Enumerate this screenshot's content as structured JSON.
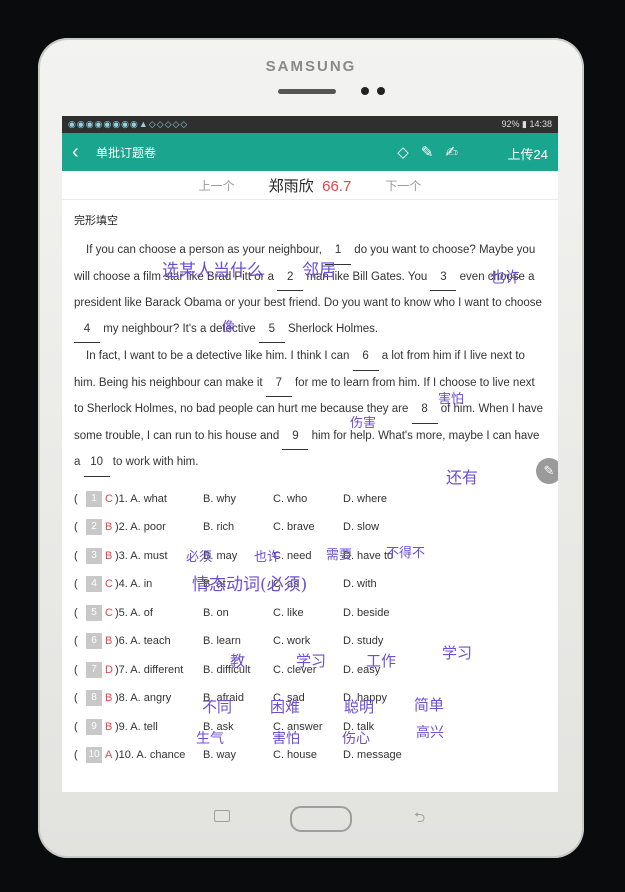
{
  "device": {
    "brand": "SAMSUNG"
  },
  "status_bar": {
    "left_icons": "◉◉◉◉◉◉◉◉▲◇◇◇◇◇",
    "right": "92% ▮ 14:38"
  },
  "app_bar": {
    "title": "单批订题卷",
    "upload_label": "上传24"
  },
  "student_bar": {
    "prev_label": "上一个",
    "student_name": "郑雨欣",
    "score": "66.7",
    "next_label": "下一个"
  },
  "section_title": "完形填空",
  "paragraphs": [
    {
      "segments": [
        "If you can choose a person as your neighbour, ",
        "1",
        " do you want to choose? Maybe you will choose a film star like Brad Pitt or a ",
        "2",
        " man like Bill Gates. You ",
        "3",
        " even choose a president like Barack Obama or your best friend. Do you want to know who I want to choose ",
        "4",
        " my neighbour? It's a detective ",
        "5",
        " Sherlock Holmes."
      ]
    },
    {
      "segments": [
        "In fact, I want to be a detective like him. I think I can ",
        "6",
        " a lot from him if I live next to him. Being his neighbour can make it ",
        "7",
        " for me to learn from him. If I choose to live next to Sherlock Holmes, no bad people can hurt me because they are ",
        "8",
        " of him. When I have some trouble, I can run to his house and ",
        "9",
        " him for help. What's more, maybe I can have a ",
        "10",
        " to work with him."
      ]
    }
  ],
  "questions": [
    {
      "num": "1",
      "ans": "C",
      "a": ")1. A. what",
      "b": "B. why",
      "c": "C. who",
      "d": "D. where"
    },
    {
      "num": "2",
      "ans": "B",
      "a": ")2. A. poor",
      "b": "B. rich",
      "c": "C. brave",
      "d": "D. slow"
    },
    {
      "num": "3",
      "ans": "B",
      "a": ")3. A. must",
      "b": "B. may",
      "c": "C. need",
      "d": "D. have to"
    },
    {
      "num": "4",
      "ans": "C",
      "a": ")4. A. in",
      "b": "B. at",
      "c": "C. as",
      "d": "D. with"
    },
    {
      "num": "5",
      "ans": "C",
      "a": ")5. A. of",
      "b": "B. on",
      "c": "C. like",
      "d": "D. beside"
    },
    {
      "num": "6",
      "ans": "B",
      "a": ")6. A. teach",
      "b": "B. learn",
      "c": "C. work",
      "d": "D. study"
    },
    {
      "num": "7",
      "ans": "D",
      "a": ")7. A. different",
      "b": "B. difficult",
      "c": "C. clever",
      "d": "D. easy"
    },
    {
      "num": "8",
      "ans": "B",
      "a": ")8. A. angry",
      "b": "B. afraid",
      "c": "C. sad",
      "d": "D. happy"
    },
    {
      "num": "9",
      "ans": "B",
      "a": ")9. A. tell",
      "b": "B. ask",
      "c": "C. answer",
      "d": "D. talk"
    },
    {
      "num": "10",
      "ans": "A",
      "a": ")10. A. chance",
      "b": "B. way",
      "c": "C. house",
      "d": "D. message"
    }
  ],
  "handwriting": {
    "note_1": "选某人当什么",
    "note_2": "邻居",
    "note_3": "也许",
    "note_4": "像",
    "note_5": "伤害",
    "note_6": "害怕",
    "note_7": "还有",
    "note_8": "必须",
    "note_9": "也许",
    "note_10": "需要",
    "note_11": "不得不",
    "note_12": "情态动词(必须)",
    "note_13": "教",
    "note_14": "学习",
    "note_15": "工作",
    "note_16": "学习",
    "note_17": "不同",
    "note_18": "困难",
    "note_19": "聪明",
    "note_20": "简单",
    "note_21": "生气",
    "note_22": "害怕",
    "note_23": "伤心",
    "note_24": "高兴"
  }
}
